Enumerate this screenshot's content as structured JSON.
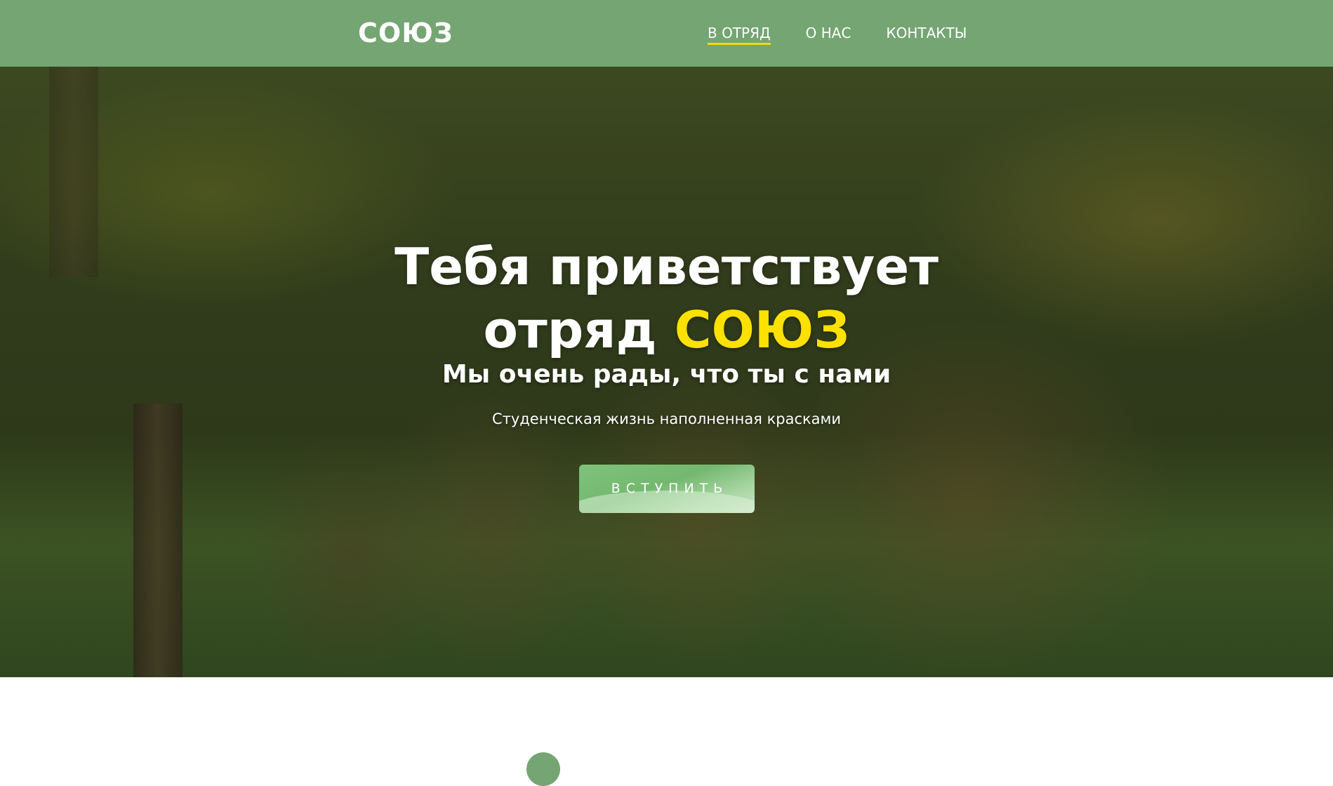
{
  "header": {
    "logo": "СОЮЗ",
    "nav": [
      {
        "label": "В ОТРЯД",
        "active": true
      },
      {
        "label": "О НАС",
        "active": false
      },
      {
        "label": "КОНТАКТЫ",
        "active": false
      }
    ]
  },
  "hero": {
    "title_line1": "Тебя приветствует",
    "title_line2_prefix": "отряд ",
    "title_line2_accent": "СОЮЗ",
    "subtitle": "Мы очень рады, что ты с нами",
    "tagline": "Студенческая жизнь наполненная красками",
    "cta_label": "ВСТУПИТЬ",
    "background_image": "group-photo"
  },
  "colors": {
    "header_bg": "#74a572",
    "accent_yellow": "#ffe100",
    "nav_underline": "#f5d90a",
    "button_green": "#74b870"
  }
}
